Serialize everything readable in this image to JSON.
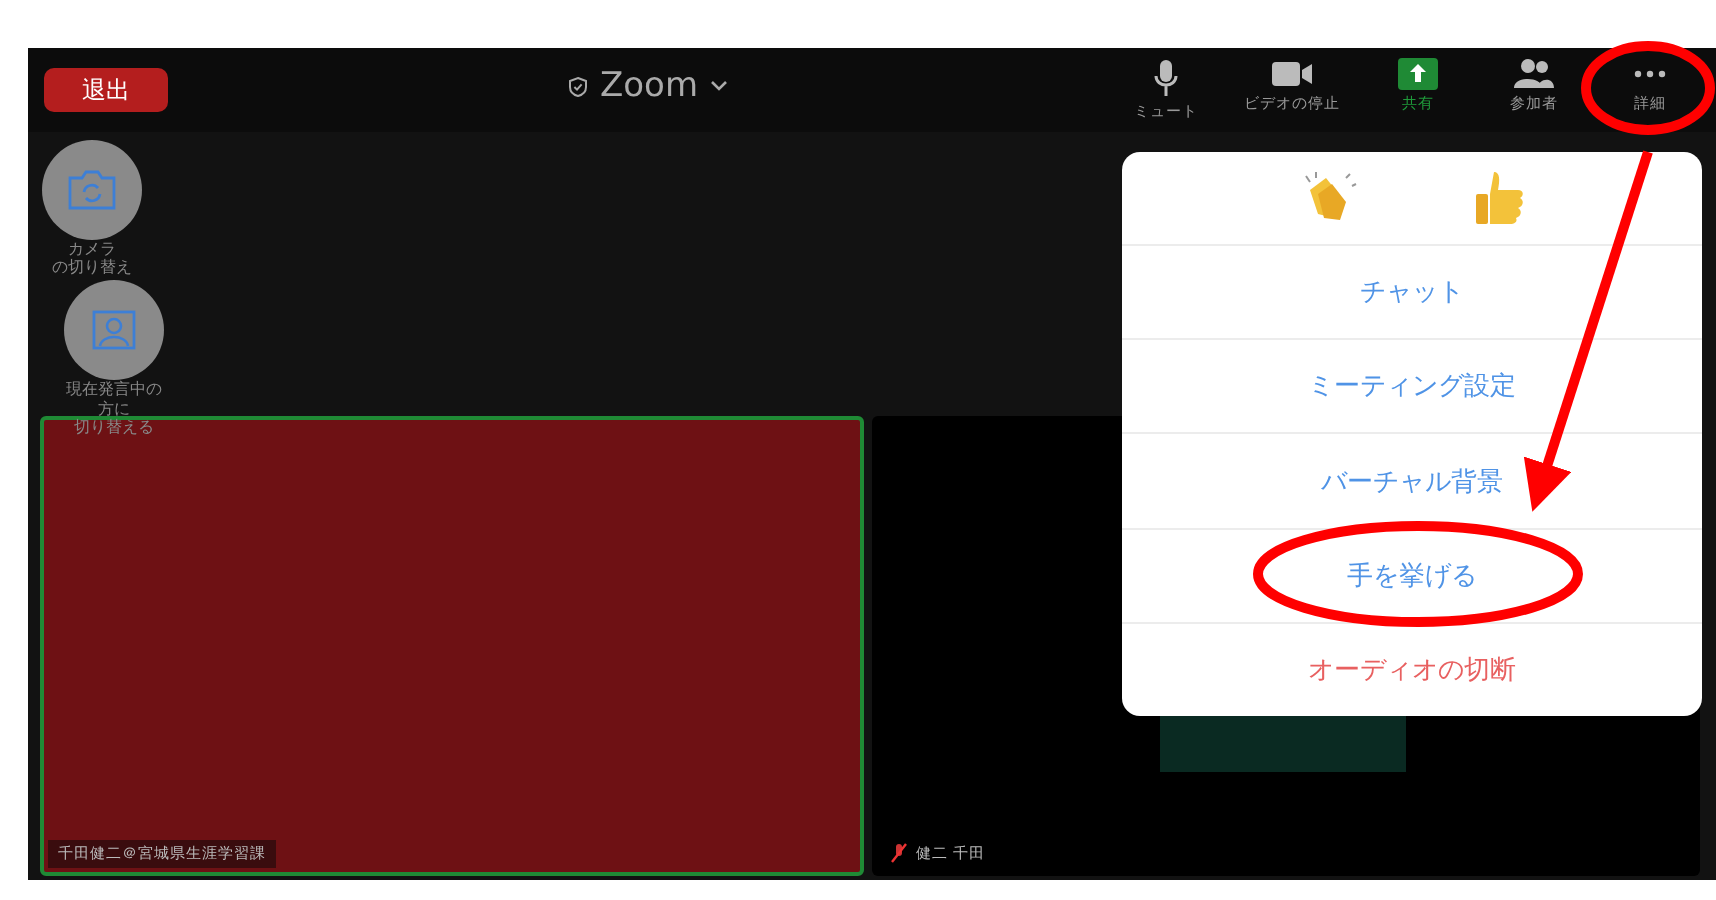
{
  "top_bar": {
    "leave_button": "退出",
    "title": "Zoom",
    "tools": [
      {
        "kind": "mic",
        "label": "ミュート"
      },
      {
        "kind": "video",
        "label": "ビデオの停止"
      },
      {
        "kind": "share",
        "label": "共有"
      },
      {
        "kind": "participants",
        "label": "参加者"
      },
      {
        "kind": "more",
        "label": "詳細"
      }
    ]
  },
  "side_buttons": [
    {
      "kind": "camera",
      "lines": [
        "カメラ",
        "の切り替え"
      ]
    },
    {
      "kind": "speaker",
      "lines": [
        "現在発言中の",
        "方に",
        "切り替える"
      ]
    }
  ],
  "tiles": [
    {
      "name": "千田健二＠宮城県生涯学習課",
      "active": true,
      "muted": false
    },
    {
      "name": "健二 千田",
      "active": false,
      "muted": true
    }
  ],
  "menu": {
    "reactions": [
      {
        "kind": "clap"
      },
      {
        "kind": "thumbs"
      }
    ],
    "items": [
      {
        "label": "チャット",
        "danger": false
      },
      {
        "label": "ミーティング設定",
        "danger": false
      },
      {
        "label": "バーチャル背景",
        "danger": false
      },
      {
        "label": "手を挙げる",
        "danger": false
      },
      {
        "label": "オーディオの切断",
        "danger": true
      }
    ]
  },
  "annotations": [
    {
      "kind": "circle"
    },
    {
      "kind": "arrow"
    },
    {
      "kind": "ellipse"
    }
  ]
}
